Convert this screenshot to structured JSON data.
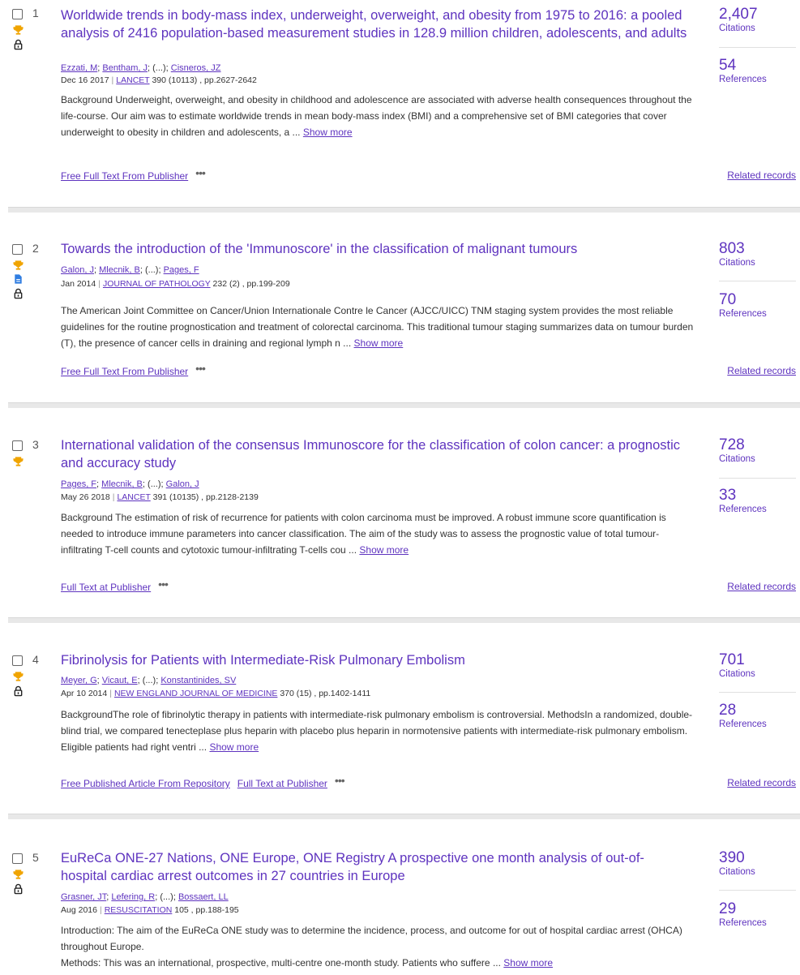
{
  "records": [
    {
      "index": "1",
      "title": "Worldwide trends in body-mass index, underweight, overweight, and obesity from 1975 to 2016: a pooled analysis of 2416 population-based measurement studies in 128.9 million children, adolescents, and adults",
      "authors": [
        "Ezzati, M",
        "Bentham, J",
        "(...)",
        "Cisneros, JZ"
      ],
      "date": "Dec 16 2017",
      "journal": "LANCET",
      "volume_pages": "390 (10113) , pp.2627-2642",
      "abstract": "Background Underweight, overweight, and obesity in childhood and adolescence are associated with adverse health consequences throughout the life-course. Our aim was to estimate worldwide trends in mean body-mass index (BMI) and a comprehensive set of BMI categories that cover underweight to obesity in children and adolescents, a ...",
      "show_more": "Show more",
      "links": [
        "Free Full Text From Publisher"
      ],
      "citations": "2,407",
      "citations_label": "Citations",
      "references": "54",
      "references_label": "References",
      "related": "Related records"
    },
    {
      "index": "2",
      "title": "Towards the introduction of the 'Immunoscore' in the classification of malignant tumours",
      "authors": [
        "Galon, J",
        "Mlecnik, B",
        "(...)",
        "Pages, F"
      ],
      "date": "Jan 2014",
      "journal": "JOURNAL OF PATHOLOGY",
      "volume_pages": "232 (2) , pp.199-209",
      "abstract": "The American Joint Committee on Cancer/Union Internationale Contre le Cancer (AJCC/UICC) TNM staging system provides the most reliable guidelines for the routine prognostication and treatment of colorectal carcinoma. This traditional tumour staging summarizes data on tumour burden (T), the presence of cancer cells in draining and regional lymph n ...",
      "show_more": "Show more",
      "links": [
        "Free Full Text From Publisher"
      ],
      "citations": "803",
      "citations_label": "Citations",
      "references": "70",
      "references_label": "References",
      "related": "Related records"
    },
    {
      "index": "3",
      "title": "International validation of the consensus Immunoscore for the classification of colon cancer: a prognostic and accuracy study",
      "authors": [
        "Pages, F",
        "Mlecnik, B",
        "(...)",
        "Galon, J"
      ],
      "date": "May 26 2018",
      "journal": "LANCET",
      "volume_pages": "391 (10135) , pp.2128-2139",
      "abstract": "Background The estimation of risk of recurrence for patients with colon carcinoma must be improved. A robust immune score quantification is needed to introduce immune parameters into cancer classification. The aim of the study was to assess the prognostic value of total tumour-infiltrating T-cell counts and cytotoxic tumour-infiltrating T-cells cou ...",
      "show_more": "Show more",
      "links": [
        "Full Text at Publisher"
      ],
      "citations": "728",
      "citations_label": "Citations",
      "references": "33",
      "references_label": "References",
      "related": "Related records"
    },
    {
      "index": "4",
      "title": "Fibrinolysis for Patients with Intermediate-Risk Pulmonary Embolism",
      "authors": [
        "Meyer, G",
        "Vicaut, E",
        "(...)",
        "Konstantinides, SV"
      ],
      "date": "Apr 10 2014",
      "journal": "NEW ENGLAND JOURNAL OF MEDICINE",
      "volume_pages": "370 (15) , pp.1402-1411",
      "abstract": "BackgroundThe role of fibrinolytic therapy in patients with intermediate-risk pulmonary embolism is controversial. MethodsIn a randomized, double-blind trial, we compared tenecteplase plus heparin with placebo plus heparin in normotensive patients with intermediate-risk pulmonary embolism. Eligible patients had right ventri ...",
      "show_more": "Show more",
      "links": [
        "Free Published Article From Repository",
        "Full Text at Publisher"
      ],
      "citations": "701",
      "citations_label": "Citations",
      "references": "28",
      "references_label": "References",
      "related": "Related records"
    },
    {
      "index": "5",
      "title": "EuReCa ONE-27 Nations, ONE Europe, ONE Registry A prospective one month analysis of out-of-hospital cardiac arrest outcomes in 27 countries in Europe",
      "authors": [
        "Grasner, JT",
        "Lefering, R",
        "(...)",
        "Bossaert, LL"
      ],
      "date": "Aug 2016",
      "journal": "RESUSCITATION",
      "volume_pages": "105 , pp.188-195",
      "abstract_lines": [
        "Introduction: The aim of the EuReCa ONE study was to determine the incidence, process, and outcome for out of hospital cardiac arrest (OHCA) throughout Europe.",
        "Methods: This was an international, prospective, multi-centre one-month study. Patients who suffere ..."
      ],
      "show_more": "Show more",
      "citations": "390",
      "citations_label": "Citations",
      "references": "29",
      "references_label": "References"
    }
  ],
  "colors": {
    "link": "#5e33bf",
    "trophy": "#f0a400",
    "doc": "#2f7de1"
  },
  "icons": [
    "checkbox",
    "trophy-icon",
    "document-icon",
    "lock-open-icon",
    "more-options-icon"
  ]
}
